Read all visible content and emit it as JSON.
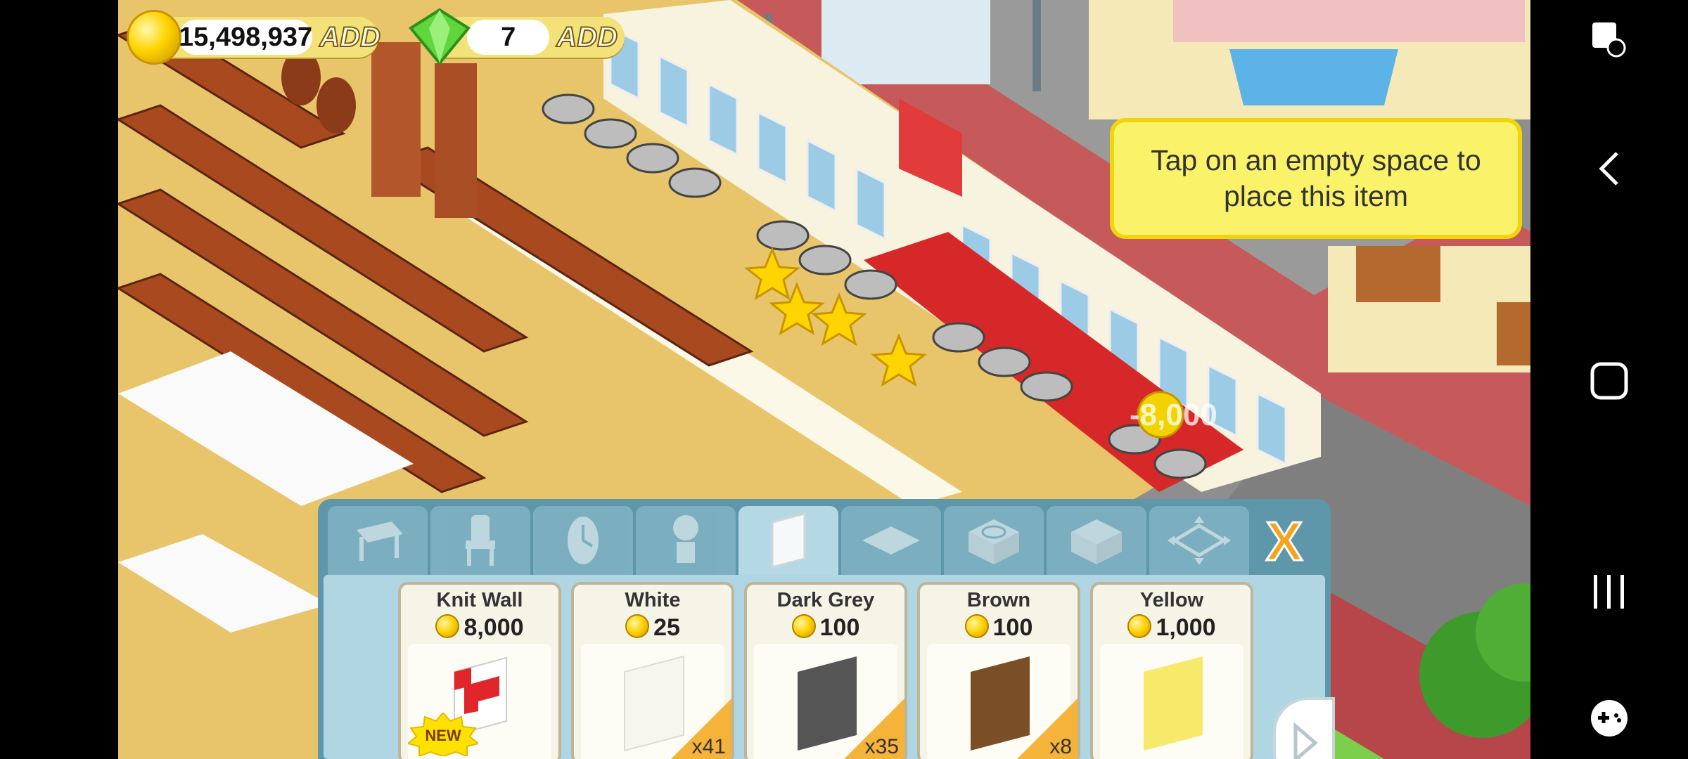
{
  "hud": {
    "coins": "15,498,937",
    "coins_add": "ADD",
    "gems": "7",
    "gems_add": "ADD"
  },
  "tooltip": "Tap on an empty space to place this item",
  "floating_text": "-8,000",
  "shop": {
    "tabs": [
      {
        "icon": "table-icon"
      },
      {
        "icon": "chair-icon"
      },
      {
        "icon": "clock-icon"
      },
      {
        "icon": "plant-icon"
      },
      {
        "icon": "wall-icon",
        "active": true
      },
      {
        "icon": "floor-icon"
      },
      {
        "icon": "stove-icon"
      },
      {
        "icon": "counter-icon"
      },
      {
        "icon": "expand-icon"
      }
    ],
    "close": "X",
    "items": [
      {
        "name": "Knit Wall",
        "price": "8,000",
        "badge": "NEW",
        "color": "#e0262a"
      },
      {
        "name": "White",
        "price": "25",
        "qty": "x41",
        "color": "#fbfaf2"
      },
      {
        "name": "Dark Grey",
        "price": "100",
        "qty": "x35",
        "color": "#555555"
      },
      {
        "name": "Brown",
        "price": "100",
        "qty": "x8",
        "color": "#7a4f25"
      },
      {
        "name": "Yellow",
        "price": "1,000",
        "color": "#f7ea6a"
      }
    ]
  },
  "nav": {
    "icons": [
      "screenshot-icon",
      "back-icon",
      "home-icon",
      "recents-icon",
      "game-tools-icon"
    ]
  }
}
